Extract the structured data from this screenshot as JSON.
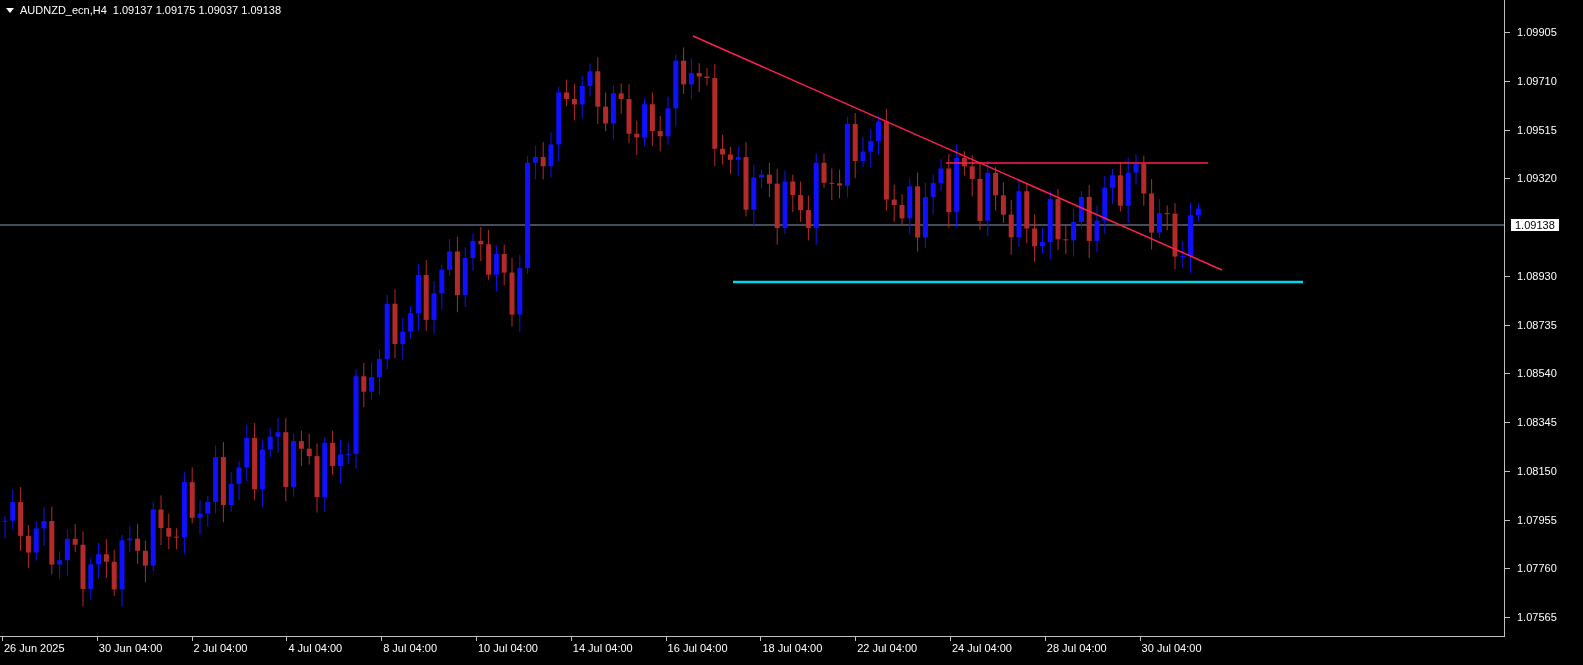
{
  "chart": {
    "symbol": "AUDNZD_ecn,H4",
    "quote": "1.09137 1.09175 1.09037 1.09138"
  },
  "price_axis": {
    "labels": [
      "1.09905",
      "1.09710",
      "1.09515",
      "1.09320",
      "1.08930",
      "1.08735",
      "1.08540",
      "1.08345",
      "1.08150",
      "1.07955",
      "1.07760",
      "1.07565"
    ],
    "current_price": "1.09138"
  },
  "time_axis": {
    "labels": [
      "26 Jun 2025",
      "30 Jun 04:00",
      "2 Jul 04:00",
      "4 Jul 04:00",
      "8 Jul 04:00",
      "10 Jul 04:00",
      "14 Jul 04:00",
      "16 Jul 04:00",
      "18 Jul 04:00",
      "22 Jul 04:00",
      "24 Jul 04:00",
      "28 Jul 04:00",
      "30 Jul 04:00"
    ]
  }
}
